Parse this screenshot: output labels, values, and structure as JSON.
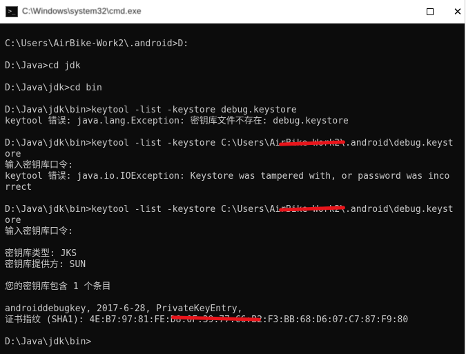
{
  "window": {
    "title": "C:\\Windows\\system32\\cmd.exe",
    "icon": "terminal-icon",
    "maximize_symbol": "",
    "close_symbol": "✕"
  },
  "console": {
    "lines": [
      "",
      "C:\\Users\\AirBike-Work2\\.android>D:",
      "",
      "D:\\Java>cd jdk",
      "",
      "D:\\Java\\jdk>cd bin",
      "",
      "D:\\Java\\jdk\\bin>keytool -list -keystore debug.keystore",
      "keytool 错误: java.lang.Exception: 密钥库文件不存在: debug.keystore",
      "",
      "D:\\Java\\jdk\\bin>keytool -list -keystore C:\\Users\\AirBike-Work2\\.android\\debug.keyst",
      "ore",
      "输入密钥库口令:",
      "keytool 错误: java.io.IOException: Keystore was tampered with, or password was inco",
      "rrect",
      "",
      "D:\\Java\\jdk\\bin>keytool -list -keystore C:\\Users\\AirBike-Work2\\.android\\debug.keyst",
      "ore",
      "输入密钥库口令:",
      "",
      "密钥库类型: JKS",
      "密钥库提供方: SUN",
      "",
      "您的密钥库包含 1 个条目",
      "",
      "androiddebugkey, 2017-6-28, PrivateKeyEntry,",
      "证书指纹 (SHA1): 4E:B7:97:81:FE:D8:0F:39:77:C6:B2:F3:BB:68:D6:07:C7:87:F9:80",
      "",
      "D:\\Java\\jdk\\bin>"
    ]
  },
  "colors": {
    "background": "#0c0c0c",
    "text": "#c8c8c8",
    "redaction": "#e8151b"
  }
}
